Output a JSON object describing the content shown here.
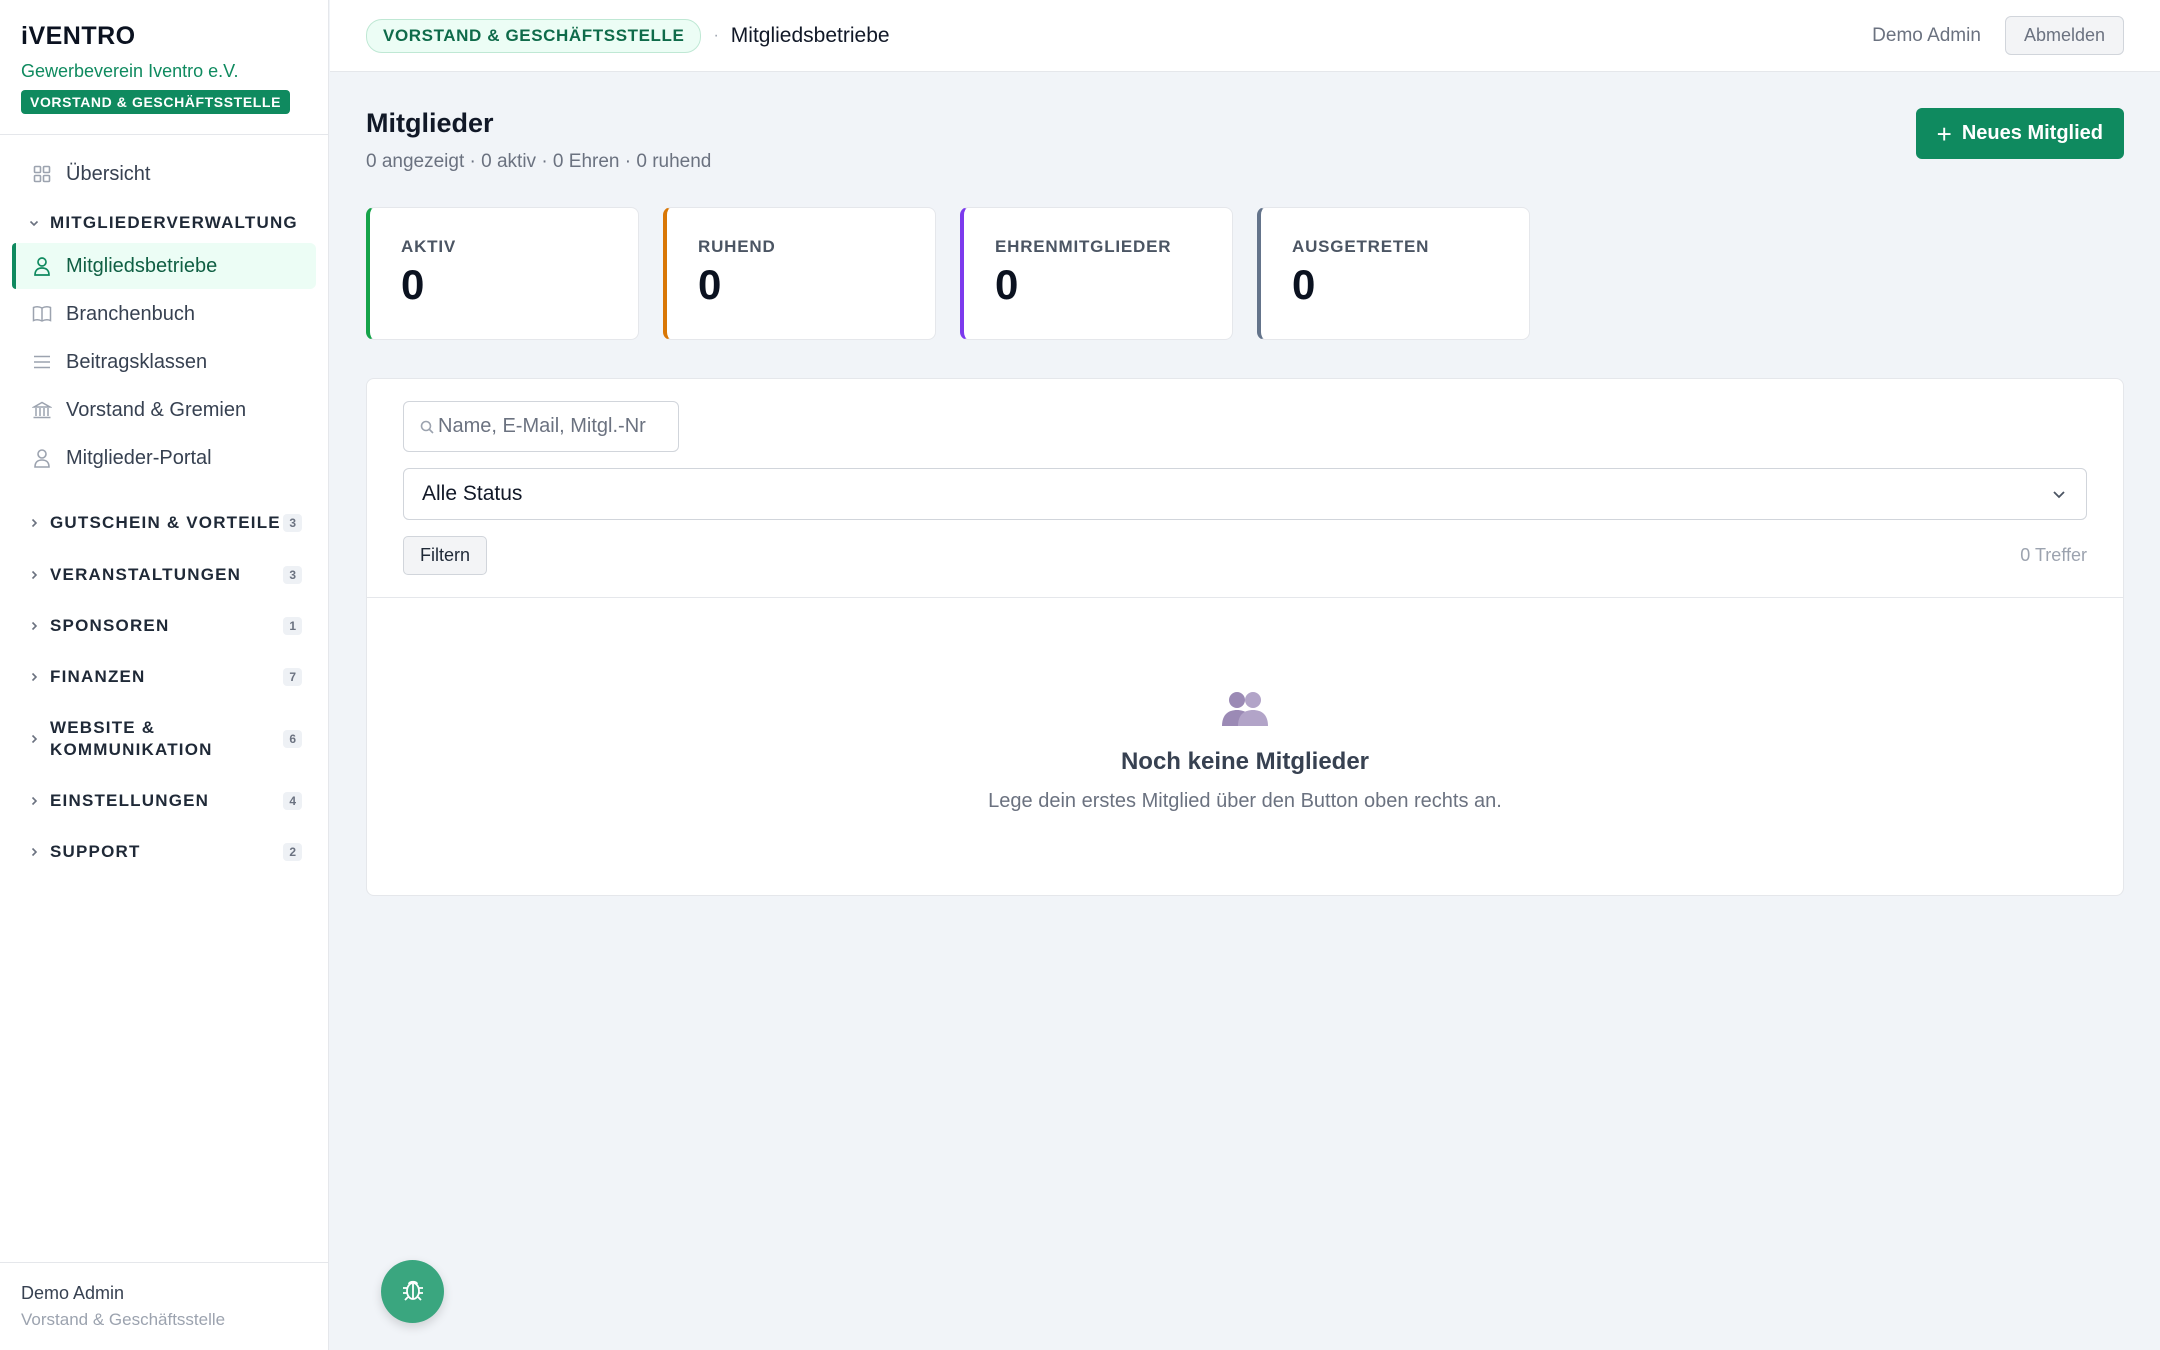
{
  "brand": {
    "logo": "iVENTRO",
    "org": "Gewerbeverein Iventro e.V.",
    "role_badge": "VORSTAND & GESCHÄFTSSTELLE"
  },
  "sidebar": {
    "top_item": {
      "label": "Übersicht",
      "icon": "grid-icon"
    },
    "open_group": {
      "title": "MITGLIEDERVERWALTUNG",
      "items": [
        {
          "label": "Mitgliedsbetriebe",
          "icon": "user-icon",
          "active": true
        },
        {
          "label": "Branchenbuch",
          "icon": "book-icon"
        },
        {
          "label": "Beitragsklassen",
          "icon": "list-icon"
        },
        {
          "label": "Vorstand & Gremien",
          "icon": "building-icon"
        },
        {
          "label": "Mitglieder-Portal",
          "icon": "user-icon"
        }
      ]
    },
    "groups": [
      {
        "title": "GUTSCHEIN & VORTEILE",
        "count": "3"
      },
      {
        "title": "VERANSTALTUNGEN",
        "count": "3"
      },
      {
        "title": "SPONSOREN",
        "count": "1"
      },
      {
        "title": "FINANZEN",
        "count": "7"
      },
      {
        "title": "WEBSITE & KOMMUNIKATION",
        "count": "6"
      },
      {
        "title": "EINSTELLUNGEN",
        "count": "4"
      },
      {
        "title": "SUPPORT",
        "count": "2"
      }
    ],
    "footer": {
      "name": "Demo Admin",
      "role": "Vorstand & Geschäftsstelle"
    }
  },
  "topbar": {
    "badge": "VORSTAND & GESCHÄFTSSTELLE",
    "separator": "·",
    "current": "Mitgliedsbetriebe",
    "user": "Demo Admin",
    "logout_label": "Abmelden"
  },
  "page": {
    "title": "Mitglieder",
    "subtitle": "0 angezeigt · 0 aktiv · 0 Ehren · 0 ruhend",
    "new_button": "Neues Mitglied"
  },
  "stats": [
    {
      "label": "AKTIV",
      "value": "0",
      "color": "#16a34a"
    },
    {
      "label": "RUHEND",
      "value": "0",
      "color": "#d97706"
    },
    {
      "label": "EHRENMITGLIEDER",
      "value": "0",
      "color": "#7c3aed"
    },
    {
      "label": "AUSGETRETEN",
      "value": "0",
      "color": "#64748b"
    }
  ],
  "filters": {
    "search_placeholder": "Name, E-Mail, Mitgl.-Nr",
    "status_selected": "Alle Status",
    "filter_button": "Filtern",
    "hits": "0 Treffer"
  },
  "empty_state": {
    "icon": "users-icon",
    "title": "Noch keine Mitglieder",
    "text": "Lege dein erstes Mitglied über den Button oben rechts an."
  },
  "fab": {
    "icon": "bug-icon"
  },
  "colors": {
    "accent": "#0f8a5f",
    "empty_icon": "#9b8ab5"
  }
}
